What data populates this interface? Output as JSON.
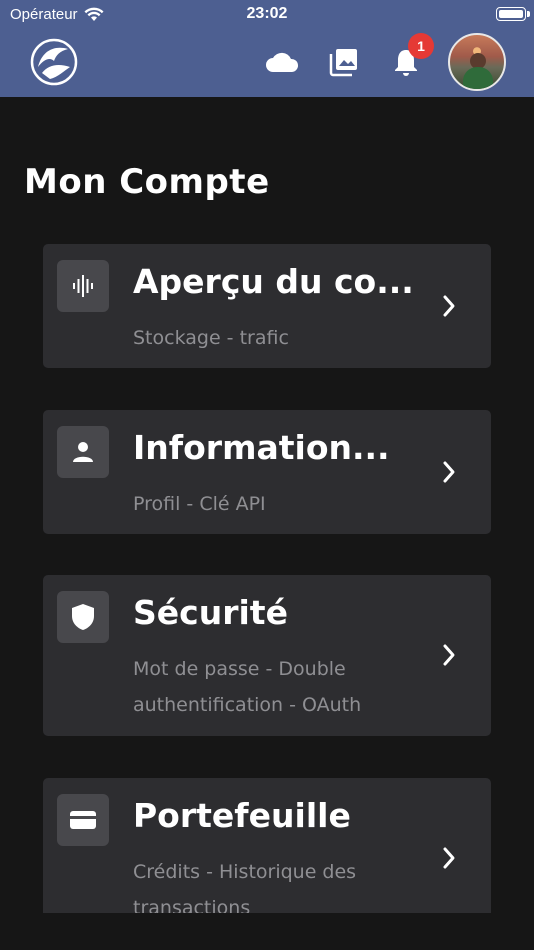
{
  "status_bar": {
    "carrier": "Opérateur",
    "time": "23:02"
  },
  "header": {
    "logo": "brand-logo",
    "icons": [
      "cloud-icon",
      "photos-icon",
      "bell-icon"
    ],
    "notification_count": "1",
    "accent_color": "#4d5f91",
    "badge_color": "#e53935"
  },
  "page": {
    "title": "Mon Compte"
  },
  "cards": [
    {
      "icon": "audio-wave-icon",
      "title": "Aperçu du co...",
      "subtitle": "Stockage - trafic"
    },
    {
      "icon": "person-icon",
      "title": "Information...",
      "subtitle": "Profil - Clé API"
    },
    {
      "icon": "shield-icon",
      "title": "Sécurité",
      "subtitle": "Mot de passe - Double authentification - OAuth"
    },
    {
      "icon": "wallet-icon",
      "title": "Portefeuille",
      "subtitle": "Crédits - Historique des transactions"
    }
  ]
}
